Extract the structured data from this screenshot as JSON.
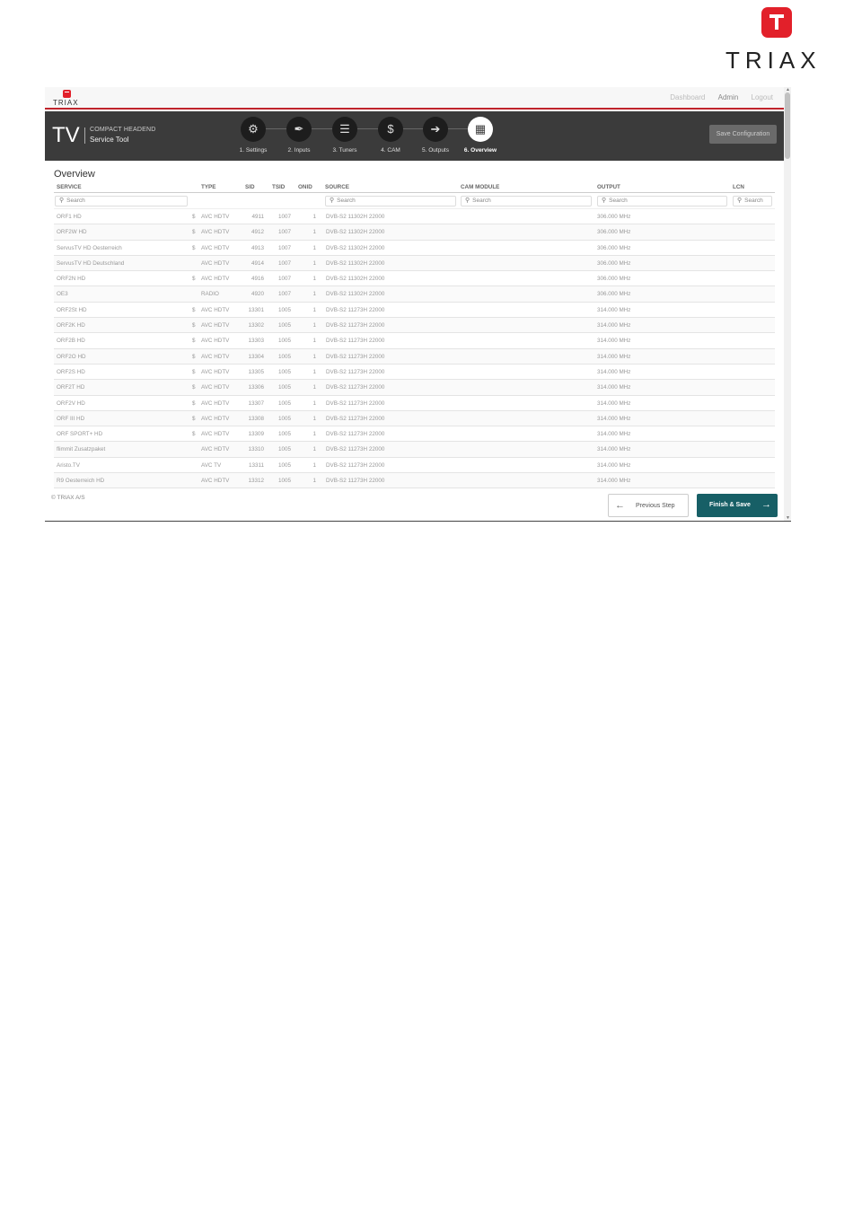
{
  "brand": {
    "name": "TRIAX"
  },
  "topbar": {
    "links": [
      "Dashboard",
      "Admin",
      "Logout"
    ],
    "active": "Admin"
  },
  "header": {
    "tv": "TV",
    "product": "COMPACT HEADEND",
    "subtitle": "Service Tool",
    "save_label": "Save Configuration"
  },
  "steps": [
    {
      "label": "1. Settings",
      "icon": "gear-icon"
    },
    {
      "label": "2. Inputs",
      "icon": "satellite-icon"
    },
    {
      "label": "3. Tuners",
      "icon": "sliders-icon"
    },
    {
      "label": "4. CAM",
      "icon": "cam-card-icon"
    },
    {
      "label": "5. Outputs",
      "icon": "output-arrow-icon"
    },
    {
      "label": "6. Overview",
      "icon": "grid-icon",
      "active": true
    }
  ],
  "overview": {
    "title": "Overview",
    "columns": {
      "service": "SERVICE",
      "type": "TYPE",
      "sid": "SID",
      "tsid": "TSID",
      "onid": "ONID",
      "source": "SOURCE",
      "cam": "CAM MODULE",
      "output": "OUTPUT",
      "lcn": "LCN"
    },
    "search_placeholder": "Search",
    "rows": [
      {
        "service": "ORF1 HD",
        "scrambled": "$",
        "type": "AVC HDTV",
        "sid": "4911",
        "tsid": "1007",
        "onid": "1",
        "source": "DVB-S2 11302H 22000",
        "output": "306.000 MHz"
      },
      {
        "service": "ORF2W HD",
        "scrambled": "$",
        "type": "AVC HDTV",
        "sid": "4912",
        "tsid": "1007",
        "onid": "1",
        "source": "DVB-S2 11302H 22000",
        "output": "306.000 MHz"
      },
      {
        "service": "ServusTV HD Oesterreich",
        "scrambled": "$",
        "type": "AVC HDTV",
        "sid": "4913",
        "tsid": "1007",
        "onid": "1",
        "source": "DVB-S2 11302H 22000",
        "output": "306.000 MHz"
      },
      {
        "service": "ServusTV HD Deutschland",
        "scrambled": "",
        "type": "AVC HDTV",
        "sid": "4914",
        "tsid": "1007",
        "onid": "1",
        "source": "DVB-S2 11302H 22000",
        "output": "306.000 MHz"
      },
      {
        "service": "ORF2N HD",
        "scrambled": "$",
        "type": "AVC HDTV",
        "sid": "4916",
        "tsid": "1007",
        "onid": "1",
        "source": "DVB-S2 11302H 22000",
        "output": "306.000 MHz"
      },
      {
        "service": "OE3",
        "scrambled": "",
        "type": "RADIO",
        "sid": "4920",
        "tsid": "1007",
        "onid": "1",
        "source": "DVB-S2 11302H 22000",
        "output": "306.000 MHz"
      },
      {
        "service": "ORF2St HD",
        "scrambled": "$",
        "type": "AVC HDTV",
        "sid": "13301",
        "tsid": "1005",
        "onid": "1",
        "source": "DVB-S2 11273H 22000",
        "output": "314.000 MHz"
      },
      {
        "service": "ORF2K HD",
        "scrambled": "$",
        "type": "AVC HDTV",
        "sid": "13302",
        "tsid": "1005",
        "onid": "1",
        "source": "DVB-S2 11273H 22000",
        "output": "314.000 MHz"
      },
      {
        "service": "ORF2B HD",
        "scrambled": "$",
        "type": "AVC HDTV",
        "sid": "13303",
        "tsid": "1005",
        "onid": "1",
        "source": "DVB-S2 11273H 22000",
        "output": "314.000 MHz"
      },
      {
        "service": "ORF2O HD",
        "scrambled": "$",
        "type": "AVC HDTV",
        "sid": "13304",
        "tsid": "1005",
        "onid": "1",
        "source": "DVB-S2 11273H 22000",
        "output": "314.000 MHz"
      },
      {
        "service": "ORF2S HD",
        "scrambled": "$",
        "type": "AVC HDTV",
        "sid": "13305",
        "tsid": "1005",
        "onid": "1",
        "source": "DVB-S2 11273H 22000",
        "output": "314.000 MHz"
      },
      {
        "service": "ORF2T HD",
        "scrambled": "$",
        "type": "AVC HDTV",
        "sid": "13306",
        "tsid": "1005",
        "onid": "1",
        "source": "DVB-S2 11273H 22000",
        "output": "314.000 MHz"
      },
      {
        "service": "ORF2V HD",
        "scrambled": "$",
        "type": "AVC HDTV",
        "sid": "13307",
        "tsid": "1005",
        "onid": "1",
        "source": "DVB-S2 11273H 22000",
        "output": "314.000 MHz"
      },
      {
        "service": "ORF III HD",
        "scrambled": "$",
        "type": "AVC HDTV",
        "sid": "13308",
        "tsid": "1005",
        "onid": "1",
        "source": "DVB-S2 11273H 22000",
        "output": "314.000 MHz"
      },
      {
        "service": "ORF SPORT+ HD",
        "scrambled": "$",
        "type": "AVC HDTV",
        "sid": "13309",
        "tsid": "1005",
        "onid": "1",
        "source": "DVB-S2 11273H 22000",
        "output": "314.000 MHz"
      },
      {
        "service": "flimmit Zusatzpaket",
        "scrambled": "",
        "type": "AVC HDTV",
        "sid": "13310",
        "tsid": "1005",
        "onid": "1",
        "source": "DVB-S2 11273H 22000",
        "output": "314.000 MHz"
      },
      {
        "service": "Aristo.TV",
        "scrambled": "",
        "type": "AVC TV",
        "sid": "13311",
        "tsid": "1005",
        "onid": "1",
        "source": "DVB-S2 11273H 22000",
        "output": "314.000 MHz"
      },
      {
        "service": "R9 Oesterreich HD",
        "scrambled": "",
        "type": "AVC HDTV",
        "sid": "13312",
        "tsid": "1005",
        "onid": "1",
        "source": "DVB-S2 11273H 22000",
        "output": "314.000 MHz"
      }
    ]
  },
  "footer": {
    "copyright": "© TRIAX A/S",
    "prev_label": "Previous Step",
    "finish_label": "Finish & Save"
  },
  "colors": {
    "brand_red": "#e2202a",
    "header_bg": "#3b3b3b",
    "finish_bg": "#175f66"
  }
}
